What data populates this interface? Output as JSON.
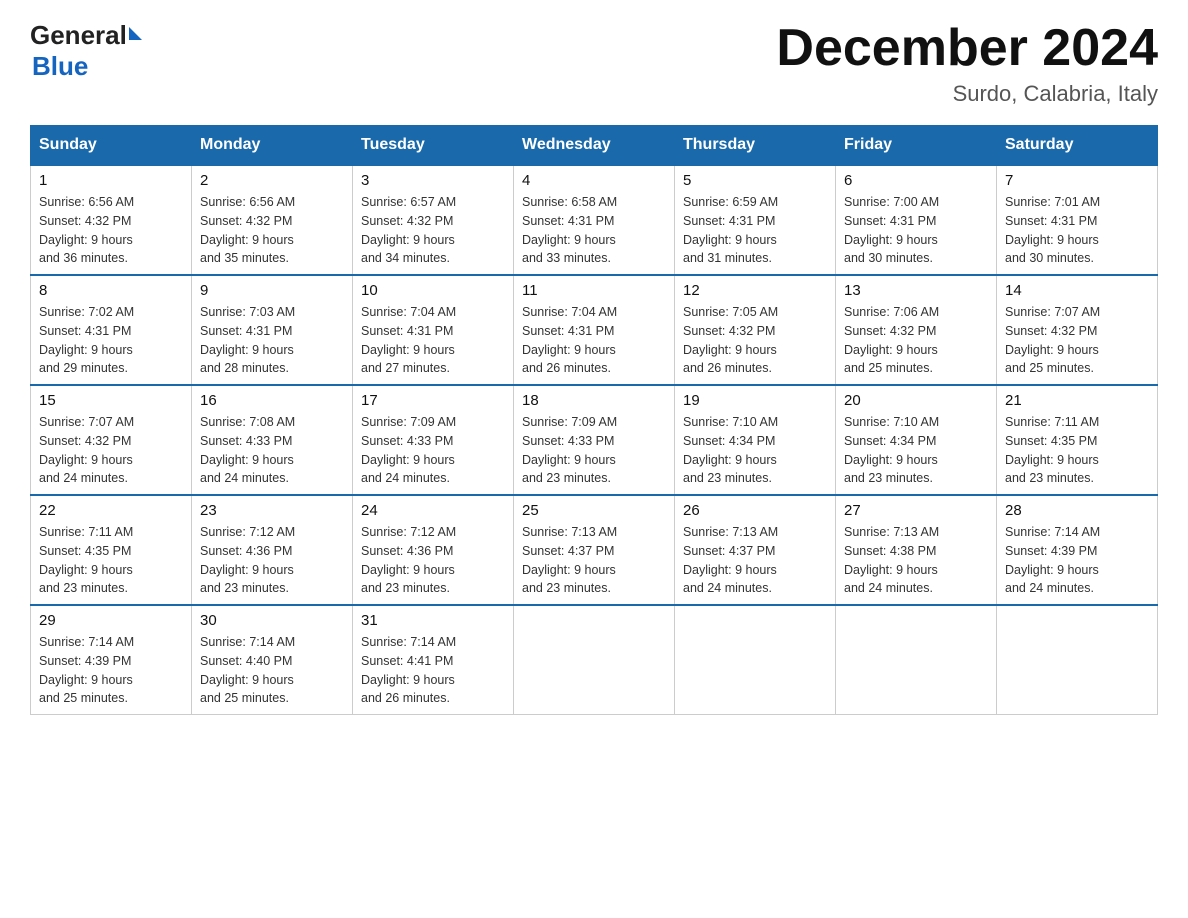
{
  "header": {
    "logo": {
      "general": "General",
      "blue": "Blue"
    },
    "title": "December 2024",
    "location": "Surdo, Calabria, Italy"
  },
  "calendar": {
    "weekdays": [
      "Sunday",
      "Monday",
      "Tuesday",
      "Wednesday",
      "Thursday",
      "Friday",
      "Saturday"
    ],
    "weeks": [
      [
        {
          "day": "1",
          "sunrise": "6:56 AM",
          "sunset": "4:32 PM",
          "daylight": "9 hours and 36 minutes."
        },
        {
          "day": "2",
          "sunrise": "6:56 AM",
          "sunset": "4:32 PM",
          "daylight": "9 hours and 35 minutes."
        },
        {
          "day": "3",
          "sunrise": "6:57 AM",
          "sunset": "4:32 PM",
          "daylight": "9 hours and 34 minutes."
        },
        {
          "day": "4",
          "sunrise": "6:58 AM",
          "sunset": "4:31 PM",
          "daylight": "9 hours and 33 minutes."
        },
        {
          "day": "5",
          "sunrise": "6:59 AM",
          "sunset": "4:31 PM",
          "daylight": "9 hours and 31 minutes."
        },
        {
          "day": "6",
          "sunrise": "7:00 AM",
          "sunset": "4:31 PM",
          "daylight": "9 hours and 30 minutes."
        },
        {
          "day": "7",
          "sunrise": "7:01 AM",
          "sunset": "4:31 PM",
          "daylight": "9 hours and 30 minutes."
        }
      ],
      [
        {
          "day": "8",
          "sunrise": "7:02 AM",
          "sunset": "4:31 PM",
          "daylight": "9 hours and 29 minutes."
        },
        {
          "day": "9",
          "sunrise": "7:03 AM",
          "sunset": "4:31 PM",
          "daylight": "9 hours and 28 minutes."
        },
        {
          "day": "10",
          "sunrise": "7:04 AM",
          "sunset": "4:31 PM",
          "daylight": "9 hours and 27 minutes."
        },
        {
          "day": "11",
          "sunrise": "7:04 AM",
          "sunset": "4:31 PM",
          "daylight": "9 hours and 26 minutes."
        },
        {
          "day": "12",
          "sunrise": "7:05 AM",
          "sunset": "4:32 PM",
          "daylight": "9 hours and 26 minutes."
        },
        {
          "day": "13",
          "sunrise": "7:06 AM",
          "sunset": "4:32 PM",
          "daylight": "9 hours and 25 minutes."
        },
        {
          "day": "14",
          "sunrise": "7:07 AM",
          "sunset": "4:32 PM",
          "daylight": "9 hours and 25 minutes."
        }
      ],
      [
        {
          "day": "15",
          "sunrise": "7:07 AM",
          "sunset": "4:32 PM",
          "daylight": "9 hours and 24 minutes."
        },
        {
          "day": "16",
          "sunrise": "7:08 AM",
          "sunset": "4:33 PM",
          "daylight": "9 hours and 24 minutes."
        },
        {
          "day": "17",
          "sunrise": "7:09 AM",
          "sunset": "4:33 PM",
          "daylight": "9 hours and 24 minutes."
        },
        {
          "day": "18",
          "sunrise": "7:09 AM",
          "sunset": "4:33 PM",
          "daylight": "9 hours and 23 minutes."
        },
        {
          "day": "19",
          "sunrise": "7:10 AM",
          "sunset": "4:34 PM",
          "daylight": "9 hours and 23 minutes."
        },
        {
          "day": "20",
          "sunrise": "7:10 AM",
          "sunset": "4:34 PM",
          "daylight": "9 hours and 23 minutes."
        },
        {
          "day": "21",
          "sunrise": "7:11 AM",
          "sunset": "4:35 PM",
          "daylight": "9 hours and 23 minutes."
        }
      ],
      [
        {
          "day": "22",
          "sunrise": "7:11 AM",
          "sunset": "4:35 PM",
          "daylight": "9 hours and 23 minutes."
        },
        {
          "day": "23",
          "sunrise": "7:12 AM",
          "sunset": "4:36 PM",
          "daylight": "9 hours and 23 minutes."
        },
        {
          "day": "24",
          "sunrise": "7:12 AM",
          "sunset": "4:36 PM",
          "daylight": "9 hours and 23 minutes."
        },
        {
          "day": "25",
          "sunrise": "7:13 AM",
          "sunset": "4:37 PM",
          "daylight": "9 hours and 23 minutes."
        },
        {
          "day": "26",
          "sunrise": "7:13 AM",
          "sunset": "4:37 PM",
          "daylight": "9 hours and 24 minutes."
        },
        {
          "day": "27",
          "sunrise": "7:13 AM",
          "sunset": "4:38 PM",
          "daylight": "9 hours and 24 minutes."
        },
        {
          "day": "28",
          "sunrise": "7:14 AM",
          "sunset": "4:39 PM",
          "daylight": "9 hours and 24 minutes."
        }
      ],
      [
        {
          "day": "29",
          "sunrise": "7:14 AM",
          "sunset": "4:39 PM",
          "daylight": "9 hours and 25 minutes."
        },
        {
          "day": "30",
          "sunrise": "7:14 AM",
          "sunset": "4:40 PM",
          "daylight": "9 hours and 25 minutes."
        },
        {
          "day": "31",
          "sunrise": "7:14 AM",
          "sunset": "4:41 PM",
          "daylight": "9 hours and 26 minutes."
        },
        null,
        null,
        null,
        null
      ]
    ]
  }
}
